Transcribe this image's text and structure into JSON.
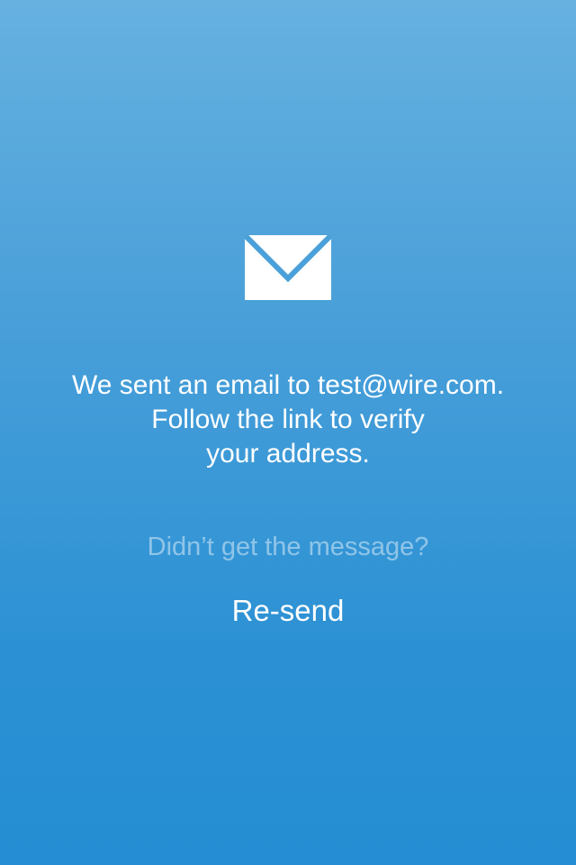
{
  "verification": {
    "message_prefix": "We sent an email to ",
    "email": "test@wire.com",
    "message_period": ".",
    "message_line2": "Follow the link to verify",
    "message_line3": "your address.",
    "question": "Didn’t get the message?",
    "resend_label": "Re-send",
    "icon": "envelope-icon"
  },
  "colors": {
    "background_top": "#66b1e0",
    "background_bottom": "#248dd3",
    "text": "#ffffff"
  }
}
